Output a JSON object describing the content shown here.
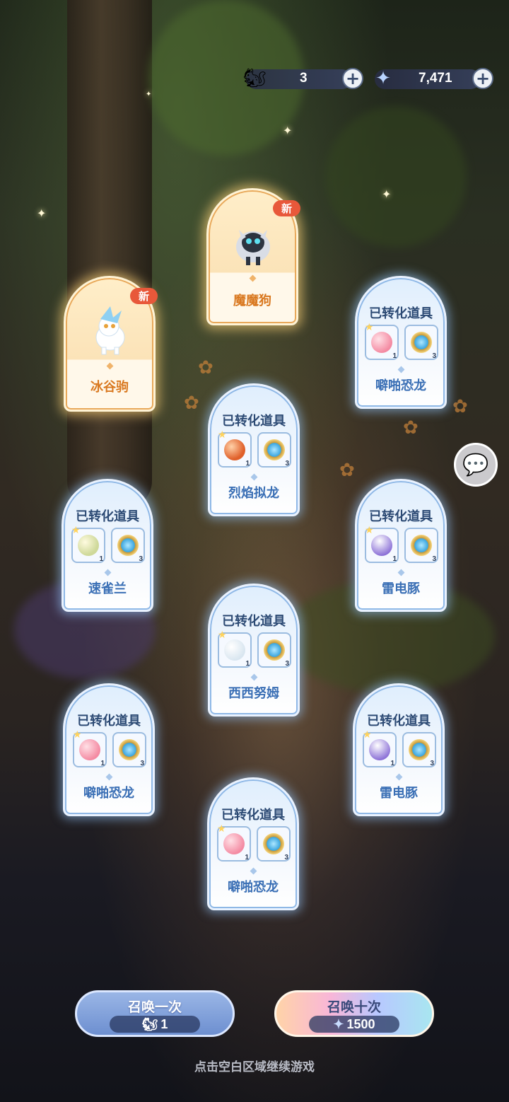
{
  "resources": {
    "tickets": {
      "icon": "summon-ticket-icon",
      "value": "3"
    },
    "stars": {
      "icon": "star-crystal-icon",
      "value": "7,471"
    }
  },
  "new_tag": "新",
  "converted_label": "已转化道具",
  "cards": [
    {
      "type": "new",
      "name": "魔魔狗",
      "art": "demon-dog-creature"
    },
    {
      "type": "new",
      "name": "冰谷驹",
      "art": "ice-pony-creature"
    },
    {
      "type": "converted",
      "name": "噼啪恐龙",
      "item1": {
        "icon": "pink-dino-icon",
        "count": "1"
      },
      "item2": {
        "icon": "cat-badge-icon",
        "count": "3"
      }
    },
    {
      "type": "converted",
      "name": "烈焰拟龙",
      "item1": {
        "icon": "fire-dragon-icon",
        "count": "1"
      },
      "item2": {
        "icon": "cat-badge-icon",
        "count": "3"
      }
    },
    {
      "type": "converted",
      "name": "速雀兰",
      "item1": {
        "icon": "leaf-bird-icon",
        "count": "1"
      },
      "item2": {
        "icon": "cat-badge-icon",
        "count": "3"
      }
    },
    {
      "type": "converted",
      "name": "雷电豚",
      "item1": {
        "icon": "thunder-dolphin-icon",
        "count": "1"
      },
      "item2": {
        "icon": "cat-badge-icon",
        "count": "3"
      }
    },
    {
      "type": "converted",
      "name": "西西努姆",
      "item1": {
        "icon": "snow-sprite-icon",
        "count": "1"
      },
      "item2": {
        "icon": "cat-badge-icon",
        "count": "3"
      }
    },
    {
      "type": "converted",
      "name": "噼啪恐龙",
      "item1": {
        "icon": "pink-dino-icon",
        "count": "1"
      },
      "item2": {
        "icon": "cat-badge-icon",
        "count": "3"
      }
    },
    {
      "type": "converted",
      "name": "雷电豚",
      "item1": {
        "icon": "thunder-dolphin-icon",
        "count": "1"
      },
      "item2": {
        "icon": "cat-badge-icon",
        "count": "3"
      }
    },
    {
      "type": "converted",
      "name": "噼啪恐龙",
      "item1": {
        "icon": "pink-dino-icon",
        "count": "1"
      },
      "item2": {
        "icon": "cat-badge-icon",
        "count": "3"
      }
    }
  ],
  "buttons": {
    "summon_once": {
      "label": "召唤一次",
      "cost": "1",
      "cost_icon": "summon-ticket-icon"
    },
    "summon_ten": {
      "label": "召唤十次",
      "cost": "1500",
      "cost_icon": "star-crystal-icon"
    }
  },
  "hint": "点击空白区域继续游戏"
}
